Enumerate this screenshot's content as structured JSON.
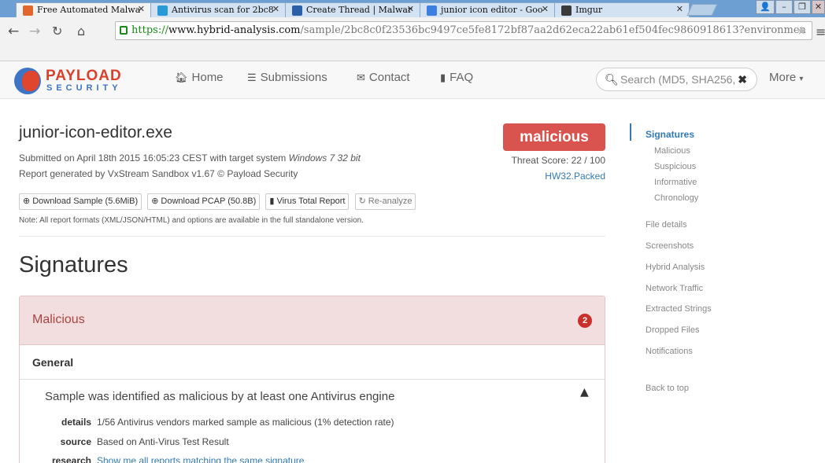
{
  "browser": {
    "tabs": [
      {
        "title": "Free Automated Malwa",
        "color": "#e2672f"
      },
      {
        "title": "Antivirus scan for 2bc8",
        "color": "#2a9ad6"
      },
      {
        "title": "Create Thread | Malwar",
        "color": "#2b5fa8"
      },
      {
        "title": "junior icon editor - Goo",
        "color": "#3d7fe0"
      },
      {
        "title": "Imgur",
        "color": "#3a3a3a"
      }
    ],
    "url": {
      "scheme": "https://",
      "host": "www.hybrid-analysis.com",
      "path": "/sample/2bc8c0f23536bc9497ce5fe8172bf87aa2d62eca22ab61ef504fec9860918613?environmen"
    }
  },
  "site": {
    "logo_line1": "PAYLOAD",
    "logo_line2": "SECURITY",
    "nav": {
      "home": "Home",
      "submissions": "Submissions",
      "contact": "Contact",
      "faq": "FAQ"
    },
    "search_placeholder": "Search (MD5, SHA256,",
    "more": "More"
  },
  "sample": {
    "filename": "junior-icon-editor.exe",
    "submitted_prefix": "Submitted on April 18th 2015 16:05:23 CEST with target system ",
    "target_system": "Windows 7 32 bit",
    "report_generated": "Report generated by VxStream Sandbox v1.67 © Payload Security",
    "buttons": {
      "download_sample": "Download Sample (5.6MiB)",
      "download_pcap": "Download PCAP (50.8B)",
      "virus_total": "Virus Total Report",
      "reanalyze": "Re-analyze"
    },
    "note": "Note: All report formats (XML/JSON/HTML) and options are available in the full standalone version.",
    "verdict": "malicious",
    "threat_score": "Threat Score: 22 / 100",
    "family": "HW32.Packed"
  },
  "signatures": {
    "heading": "Signatures",
    "malicious_label": "Malicious",
    "malicious_count": "2",
    "category": "General",
    "item_title": "Sample was identified as malicious by at least one Antivirus engine",
    "details_key": "details",
    "details_value": "1/56 Antivirus vendors marked sample as malicious (1% detection rate)",
    "source_key": "source",
    "source_value": "Based on Anti-Virus Test Result",
    "research_key": "research",
    "research_value": "Show me all reports matching the same signature"
  },
  "sidebar": {
    "active": "Signatures",
    "sub_items": [
      "Malicious",
      "Suspicious",
      "Informative",
      "Chronology"
    ],
    "items": [
      "File details",
      "Screenshots",
      "Hybrid Analysis",
      "Network Traffic",
      "Extracted Strings",
      "Dropped Files",
      "Notifications"
    ],
    "back_to_top": "Back to top"
  },
  "colors": {
    "danger": "#d9534f",
    "danger_bg": "#f2dede",
    "link": "#337ab7"
  }
}
